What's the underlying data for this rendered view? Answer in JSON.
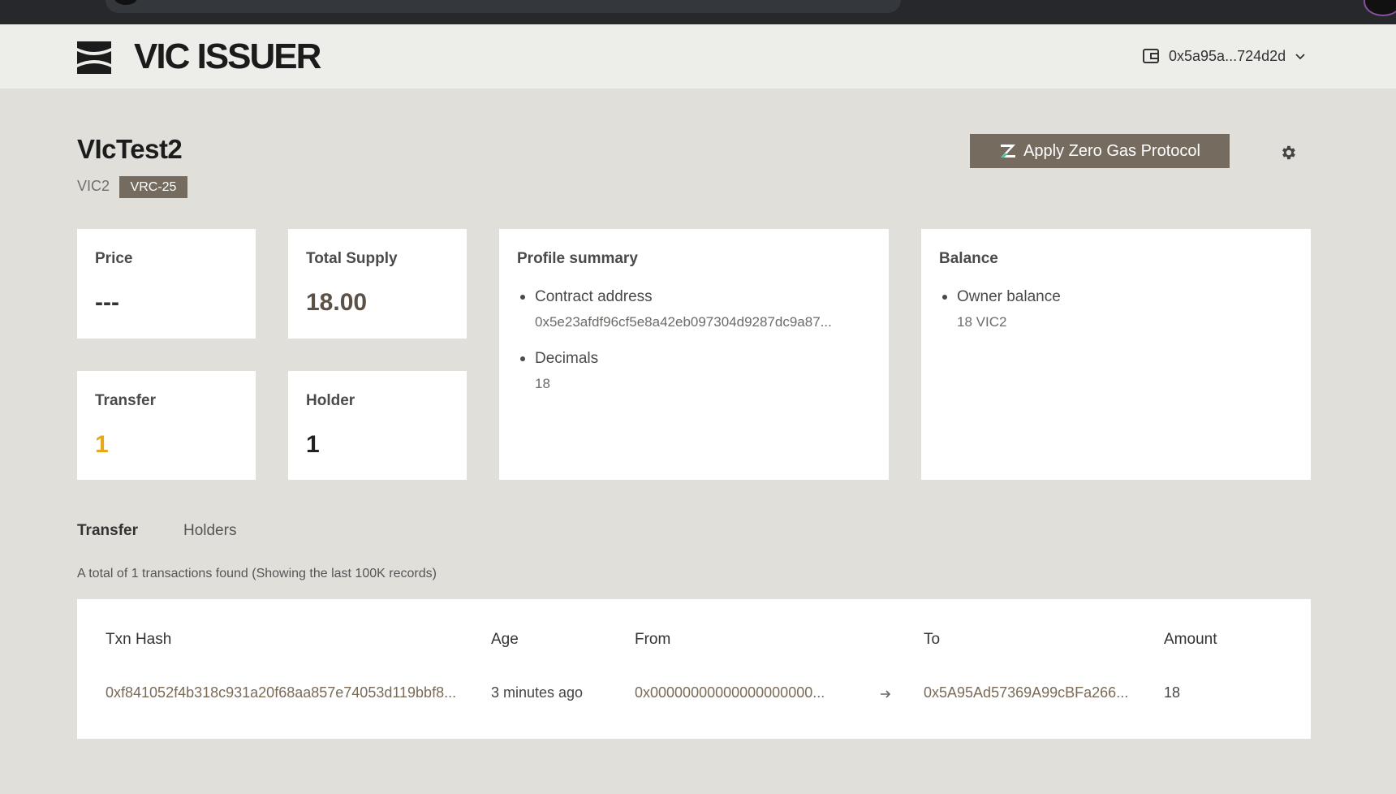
{
  "app": {
    "brand": "VIC ISSUER",
    "wallet_address": "0x5a95a...724d2d"
  },
  "token": {
    "name": "VIcTest2",
    "symbol": "VIC2",
    "standard": "VRC-25",
    "apply_button_label": "Apply Zero Gas Protocol"
  },
  "stats": {
    "price_label": "Price",
    "price_value": "---",
    "supply_label": "Total Supply",
    "supply_value": "18.00",
    "transfer_label": "Transfer",
    "transfer_value": "1",
    "holder_label": "Holder",
    "holder_value": "1"
  },
  "profile": {
    "title": "Profile summary",
    "contract_label": "Contract address",
    "contract_value": "0x5e23afdf96cf5e8a42eb097304d9287dc9a87...",
    "decimals_label": "Decimals",
    "decimals_value": "18"
  },
  "balance": {
    "title": "Balance",
    "owner_label": "Owner balance",
    "owner_value": "18 VIC2"
  },
  "tabs": {
    "transfer": "Transfer",
    "holders": "Holders"
  },
  "summary_text": "A total of 1 transactions found (Showing the last 100K records)",
  "table": {
    "headers": {
      "hash": "Txn Hash",
      "age": "Age",
      "from": "From",
      "to": "To",
      "amount": "Amount"
    },
    "rows": [
      {
        "hash": "0xf841052f4b318c931a20f68aa857e74053d119bbf8...",
        "age": "3 minutes ago",
        "from": "0x00000000000000000000...",
        "to": "0x5A95Ad57369A99cBFa266...",
        "amount": "18"
      }
    ]
  },
  "colors": {
    "background": "#e0dfda",
    "accent": "#766b5f",
    "transfer_value": "#e8a81c",
    "supply_value": "#5c5146"
  },
  "icons": {
    "logo": "vic-logo-icon",
    "wallet": "wallet-icon",
    "dropdown": "chevron-down-icon",
    "zero_gas": "zero-gas-icon",
    "settings": "gear-icon",
    "arrow": "arrow-right-icon"
  }
}
